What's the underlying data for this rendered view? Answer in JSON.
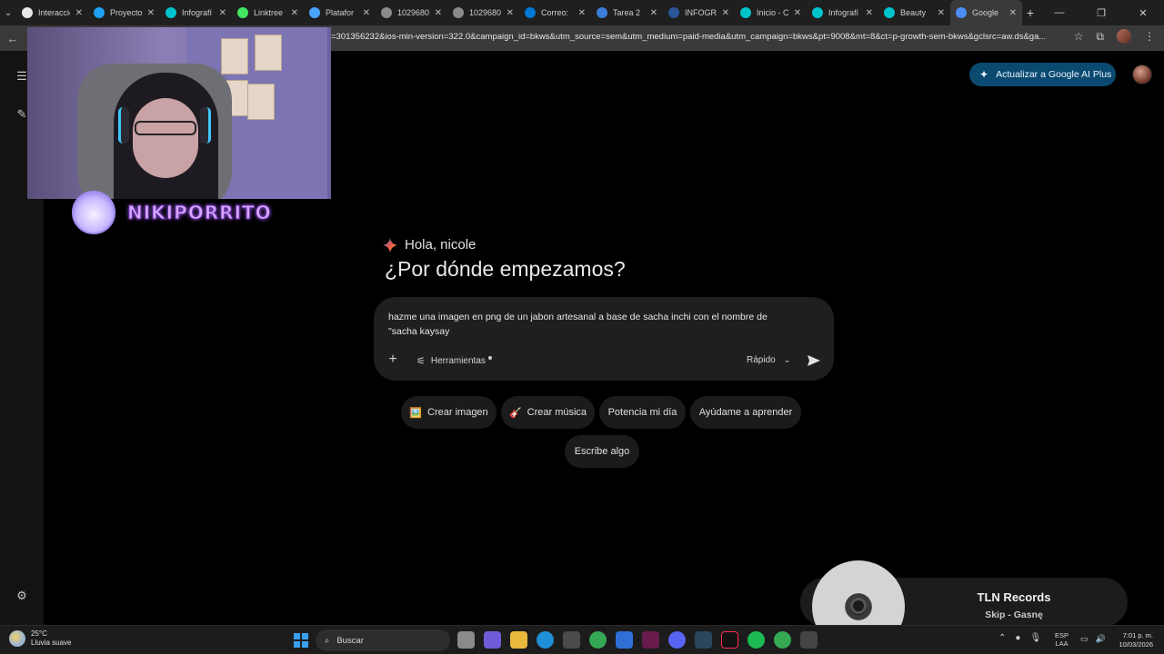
{
  "browser": {
    "tabs": [
      {
        "label": "Interacció",
        "favicon_color": "#e8e8e8"
      },
      {
        "label": "Proyecto",
        "favicon_color": "#1da1f2"
      },
      {
        "label": "Infografí",
        "favicon_color": "#00c4cc"
      },
      {
        "label": "Linktree",
        "favicon_color": "#43e660"
      },
      {
        "label": "Platafor",
        "favicon_color": "#4aa3ff"
      },
      {
        "label": "1029680",
        "favicon_color": "#8a8a8a"
      },
      {
        "label": "1029680",
        "favicon_color": "#8a8a8a"
      },
      {
        "label": "Correo: ",
        "favicon_color": "#0078d4"
      },
      {
        "label": "Tarea 2",
        "favicon_color": "#3b7dd8"
      },
      {
        "label": "INFOGR",
        "favicon_color": "#2b5797"
      },
      {
        "label": "Inicio - C",
        "favicon_color": "#00c4cc"
      },
      {
        "label": "Infografí",
        "favicon_color": "#00c4cc"
      },
      {
        "label": "Beauty",
        "favicon_color": "#00c4cc"
      },
      {
        "label": "Google",
        "favicon_color": "#4c8df6",
        "active": true
      }
    ],
    "url_visible": "=301356232&ios-min-version=322.0&campaign_id=bkws&utm_source=sem&utm_medium=paid-media&utm_campaign=bkws&pt=9008&mt=8&ct=p-growth-sem-bkws&gclsrc=aw.ds&ga..."
  },
  "gemini": {
    "upgrade_label": "Actualizar a Google AI Plus",
    "greeting": "Hola, nicole",
    "headline": "¿Por dónde empezamos?",
    "prompt_text": "hazme una imagen en png de un jabon artesanal a base de sacha inchi con el nombre de \"sacha kaysay",
    "tools_label": "Herramientas",
    "mode_label": "Rápido",
    "chips": [
      {
        "icon": "🖼️",
        "label": "Crear imagen"
      },
      {
        "icon": "🎸",
        "label": "Crear música"
      },
      {
        "icon": "",
        "label": "Potencia mi día"
      },
      {
        "icon": "",
        "label": "Ayúdame a aprender"
      },
      {
        "icon": "",
        "label": "Escribe algo"
      }
    ]
  },
  "stream_overlay": {
    "streamer_name": "NIKIPORRITO"
  },
  "music": {
    "title": "TLN Records",
    "subtitle": "Skip - Gasnę"
  },
  "taskbar": {
    "temperature": "25°C",
    "weather_desc": "Lluvia suave",
    "search_label": "Buscar",
    "lang_line1": "ESP",
    "lang_line2": "LAA",
    "time": "7:01 p. m.",
    "date": "10/03/2026"
  }
}
